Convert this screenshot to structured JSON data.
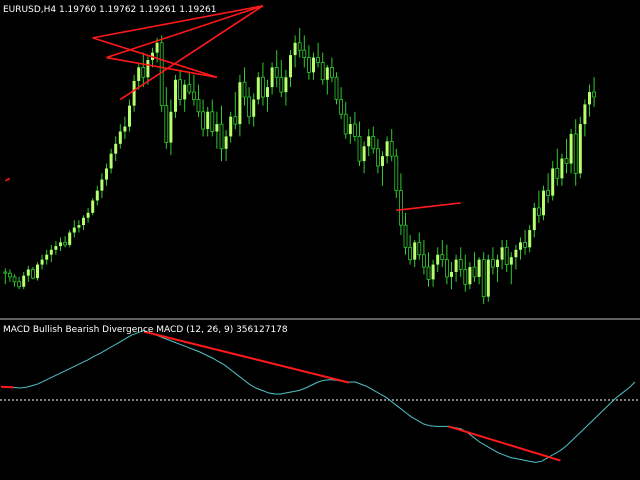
{
  "main_window": {
    "title": "EURUSD,H4  1.19760 1.19762 1.19261 1.19261"
  },
  "indicator_window": {
    "title": "MACD Bullish Bearish Divergence MACD (12, 26, 9) 356127178"
  },
  "colors": {
    "background": "#000000",
    "bull_candle": "#b8ff70",
    "bear_candle": "#000000",
    "wick": "#2ecc2e",
    "divergence_line": "#ff1a1a",
    "macd_line": "#4fc3c8",
    "zero_line": "#ffffff",
    "separator": "#c0c0c0"
  },
  "chart_data": [
    {
      "type": "candlestick",
      "symbol": "EURUSD",
      "timeframe": "H4",
      "ylim": [
        0,
        100
      ],
      "candles": [
        [
          70,
          73,
          60,
          69
        ],
        [
          69,
          72,
          62,
          66
        ],
        [
          66,
          68,
          58,
          62
        ],
        [
          62,
          66,
          56,
          58
        ],
        [
          58,
          70,
          56,
          67
        ],
        [
          67,
          75,
          62,
          72
        ],
        [
          72,
          74,
          64,
          65
        ],
        [
          65,
          78,
          63,
          76
        ],
        [
          76,
          84,
          72,
          80
        ],
        [
          80,
          88,
          76,
          84
        ],
        [
          84,
          92,
          78,
          88
        ],
        [
          88,
          95,
          84,
          91
        ],
        [
          91,
          98,
          87,
          94
        ],
        [
          94,
          99,
          90,
          92
        ],
        [
          92,
          104,
          90,
          102
        ],
        [
          102,
          112,
          98,
          106
        ],
        [
          106,
          112,
          102,
          108
        ],
        [
          108,
          116,
          104,
          114
        ],
        [
          114,
          122,
          110,
          118
        ],
        [
          118,
          130,
          116,
          128
        ],
        [
          128,
          140,
          124,
          136
        ],
        [
          136,
          150,
          130,
          145
        ],
        [
          145,
          158,
          140,
          154
        ],
        [
          154,
          170,
          150,
          166
        ],
        [
          166,
          180,
          160,
          174
        ],
        [
          174,
          190,
          170,
          184
        ],
        [
          184,
          196,
          178,
          188
        ],
        [
          188,
          210,
          184,
          205
        ],
        [
          205,
          230,
          200,
          225
        ],
        [
          225,
          240,
          218,
          236
        ],
        [
          236,
          248,
          220,
          228
        ],
        [
          228,
          245,
          222,
          242
        ],
        [
          242,
          252,
          236,
          248
        ],
        [
          248,
          260,
          240,
          256
        ],
        [
          256,
          262,
          200,
          205
        ],
        [
          205,
          220,
          170,
          175
        ],
        [
          175,
          210,
          165,
          200
        ],
        [
          200,
          230,
          195,
          226
        ],
        [
          226,
          234,
          205,
          210
        ],
        [
          210,
          226,
          200,
          222
        ],
        [
          222,
          232,
          214,
          216
        ],
        [
          216,
          230,
          205,
          210
        ],
        [
          210,
          222,
          196,
          200
        ],
        [
          200,
          210,
          180,
          186
        ],
        [
          186,
          204,
          180,
          200
        ],
        [
          200,
          210,
          180,
          184
        ],
        [
          184,
          200,
          170,
          190
        ],
        [
          190,
          205,
          160,
          170
        ],
        [
          170,
          185,
          160,
          180
        ],
        [
          180,
          200,
          175,
          196
        ],
        [
          196,
          216,
          186,
          190
        ],
        [
          190,
          230,
          180,
          224
        ],
        [
          224,
          236,
          205,
          212
        ],
        [
          212,
          220,
          190,
          196
        ],
        [
          196,
          215,
          188,
          210
        ],
        [
          210,
          232,
          206,
          228
        ],
        [
          228,
          240,
          205,
          212
        ],
        [
          212,
          226,
          200,
          220
        ],
        [
          220,
          240,
          214,
          236
        ],
        [
          236,
          250,
          220,
          228
        ],
        [
          228,
          242,
          212,
          216
        ],
        [
          216,
          234,
          205,
          228
        ],
        [
          228,
          250,
          220,
          246
        ],
        [
          246,
          262,
          236,
          256
        ],
        [
          256,
          268,
          244,
          250
        ],
        [
          250,
          262,
          236,
          244
        ],
        [
          244,
          254,
          226,
          232
        ],
        [
          232,
          248,
          226,
          244
        ],
        [
          244,
          256,
          236,
          240
        ],
        [
          240,
          248,
          222,
          226
        ],
        [
          226,
          238,
          214,
          236
        ],
        [
          236,
          244,
          224,
          228
        ],
        [
          228,
          232,
          206,
          210
        ],
        [
          210,
          220,
          194,
          198
        ],
        [
          198,
          208,
          178,
          182
        ],
        [
          182,
          196,
          174,
          190
        ],
        [
          190,
          200,
          176,
          180
        ],
        [
          180,
          192,
          156,
          160
        ],
        [
          160,
          176,
          150,
          172
        ],
        [
          172,
          186,
          164,
          180
        ],
        [
          180,
          188,
          166,
          170
        ],
        [
          170,
          178,
          150,
          156
        ],
        [
          156,
          168,
          140,
          164
        ],
        [
          164,
          180,
          158,
          176
        ],
        [
          176,
          186,
          160,
          164
        ],
        [
          164,
          170,
          130,
          136
        ],
        [
          136,
          150,
          100,
          108
        ],
        [
          108,
          118,
          84,
          90
        ],
        [
          90,
          100,
          76,
          80
        ],
        [
          80,
          96,
          74,
          94
        ],
        [
          94,
          102,
          80,
          84
        ],
        [
          84,
          96,
          68,
          74
        ],
        [
          74,
          86,
          58,
          64
        ],
        [
          64,
          80,
          58,
          76
        ],
        [
          76,
          90,
          70,
          84
        ],
        [
          84,
          96,
          74,
          80
        ],
        [
          80,
          92,
          60,
          66
        ],
        [
          66,
          78,
          56,
          70
        ],
        [
          70,
          84,
          62,
          80
        ],
        [
          80,
          90,
          66,
          72
        ],
        [
          72,
          84,
          54,
          60
        ],
        [
          60,
          78,
          56,
          74
        ],
        [
          74,
          86,
          62,
          66
        ],
        [
          66,
          82,
          60,
          80
        ],
        [
          80,
          86,
          44,
          50
        ],
        [
          50,
          84,
          46,
          80
        ],
        [
          80,
          90,
          68,
          74
        ],
        [
          74,
          84,
          62,
          80
        ],
        [
          80,
          96,
          72,
          90
        ],
        [
          90,
          96,
          70,
          76
        ],
        [
          76,
          86,
          60,
          82
        ],
        [
          82,
          92,
          72,
          88
        ],
        [
          88,
          98,
          80,
          94
        ],
        [
          94,
          104,
          84,
          90
        ],
        [
          90,
          108,
          86,
          104
        ],
        [
          104,
          126,
          98,
          122
        ],
        [
          122,
          136,
          110,
          116
        ],
        [
          116,
          140,
          112,
          136
        ],
        [
          136,
          150,
          126,
          132
        ],
        [
          132,
          160,
          128,
          154
        ],
        [
          154,
          170,
          140,
          146
        ],
        [
          146,
          166,
          140,
          162
        ],
        [
          162,
          178,
          150,
          158
        ],
        [
          158,
          186,
          150,
          182
        ],
        [
          182,
          194,
          140,
          150
        ],
        [
          150,
          196,
          146,
          190
        ],
        [
          190,
          210,
          180,
          206
        ],
        [
          206,
          222,
          196,
          216
        ],
        [
          216,
          228,
          204,
          212
        ]
      ],
      "divergence_segments": [
        {
          "from": [
            19,
            260
          ],
          "to": [
            56,
            286
          ]
        },
        {
          "from": [
            19,
            260
          ],
          "to": [
            46,
            228
          ]
        },
        {
          "from": [
            22,
            244
          ],
          "to": [
            46,
            228
          ]
        },
        {
          "from": [
            22,
            244
          ],
          "to": [
            56,
            286
          ]
        },
        {
          "from": [
            25,
            210
          ],
          "to": [
            56,
            286
          ]
        },
        {
          "from": [
            0,
            144
          ],
          "to": [
            1,
            146
          ]
        },
        {
          "from": [
            85,
            120
          ],
          "to": [
            99,
            126
          ]
        }
      ]
    },
    {
      "type": "line",
      "title": "MACD Bullish Bearish Divergence MACD (12, 26, 9) 356127178",
      "ylim": [
        -1.3,
        1.3
      ],
      "zero_level": 0,
      "series": [
        {
          "values": [
            0.22,
            0.22,
            0.21,
            0.2,
            0.21,
            0.24,
            0.27,
            0.32,
            0.37,
            0.42,
            0.47,
            0.52,
            0.57,
            0.62,
            0.67,
            0.73,
            0.78,
            0.84,
            0.9,
            0.96,
            1.02,
            1.08,
            1.12,
            1.16,
            1.12,
            1.08,
            1.04,
            1.0,
            0.96,
            0.92,
            0.88,
            0.84,
            0.8,
            0.75,
            0.7,
            0.64,
            0.58,
            0.5,
            0.42,
            0.34,
            0.26,
            0.2,
            0.16,
            0.12,
            0.1,
            0.1,
            0.12,
            0.14,
            0.16,
            0.2,
            0.25,
            0.3,
            0.33,
            0.34,
            0.33,
            0.31,
            0.3,
            0.3,
            0.26,
            0.22,
            0.16,
            0.1,
            0.04,
            -0.04,
            -0.12,
            -0.2,
            -0.28,
            -0.34,
            -0.4,
            -0.43,
            -0.44,
            -0.44,
            -0.44,
            -0.46,
            -0.48,
            -0.54,
            -0.62,
            -0.7,
            -0.76,
            -0.82,
            -0.88,
            -0.92,
            -0.96,
            -0.98,
            -1.0,
            -1.02,
            -1.04,
            -1.02,
            -0.96,
            -0.9,
            -0.84,
            -0.76,
            -0.66,
            -0.56,
            -0.46,
            -0.36,
            -0.26,
            -0.16,
            -0.06,
            0.04,
            0.12,
            0.2,
            0.3
          ]
        }
      ],
      "divergence_segments": [
        {
          "from": [
            23,
            1.14
          ],
          "to": [
            56,
            0.29
          ]
        },
        {
          "from": [
            72,
            -0.44
          ],
          "to": [
            90,
            -1.01
          ]
        },
        {
          "from": [
            0,
            0.22
          ],
          "to": [
            2,
            0.21
          ]
        }
      ]
    }
  ]
}
